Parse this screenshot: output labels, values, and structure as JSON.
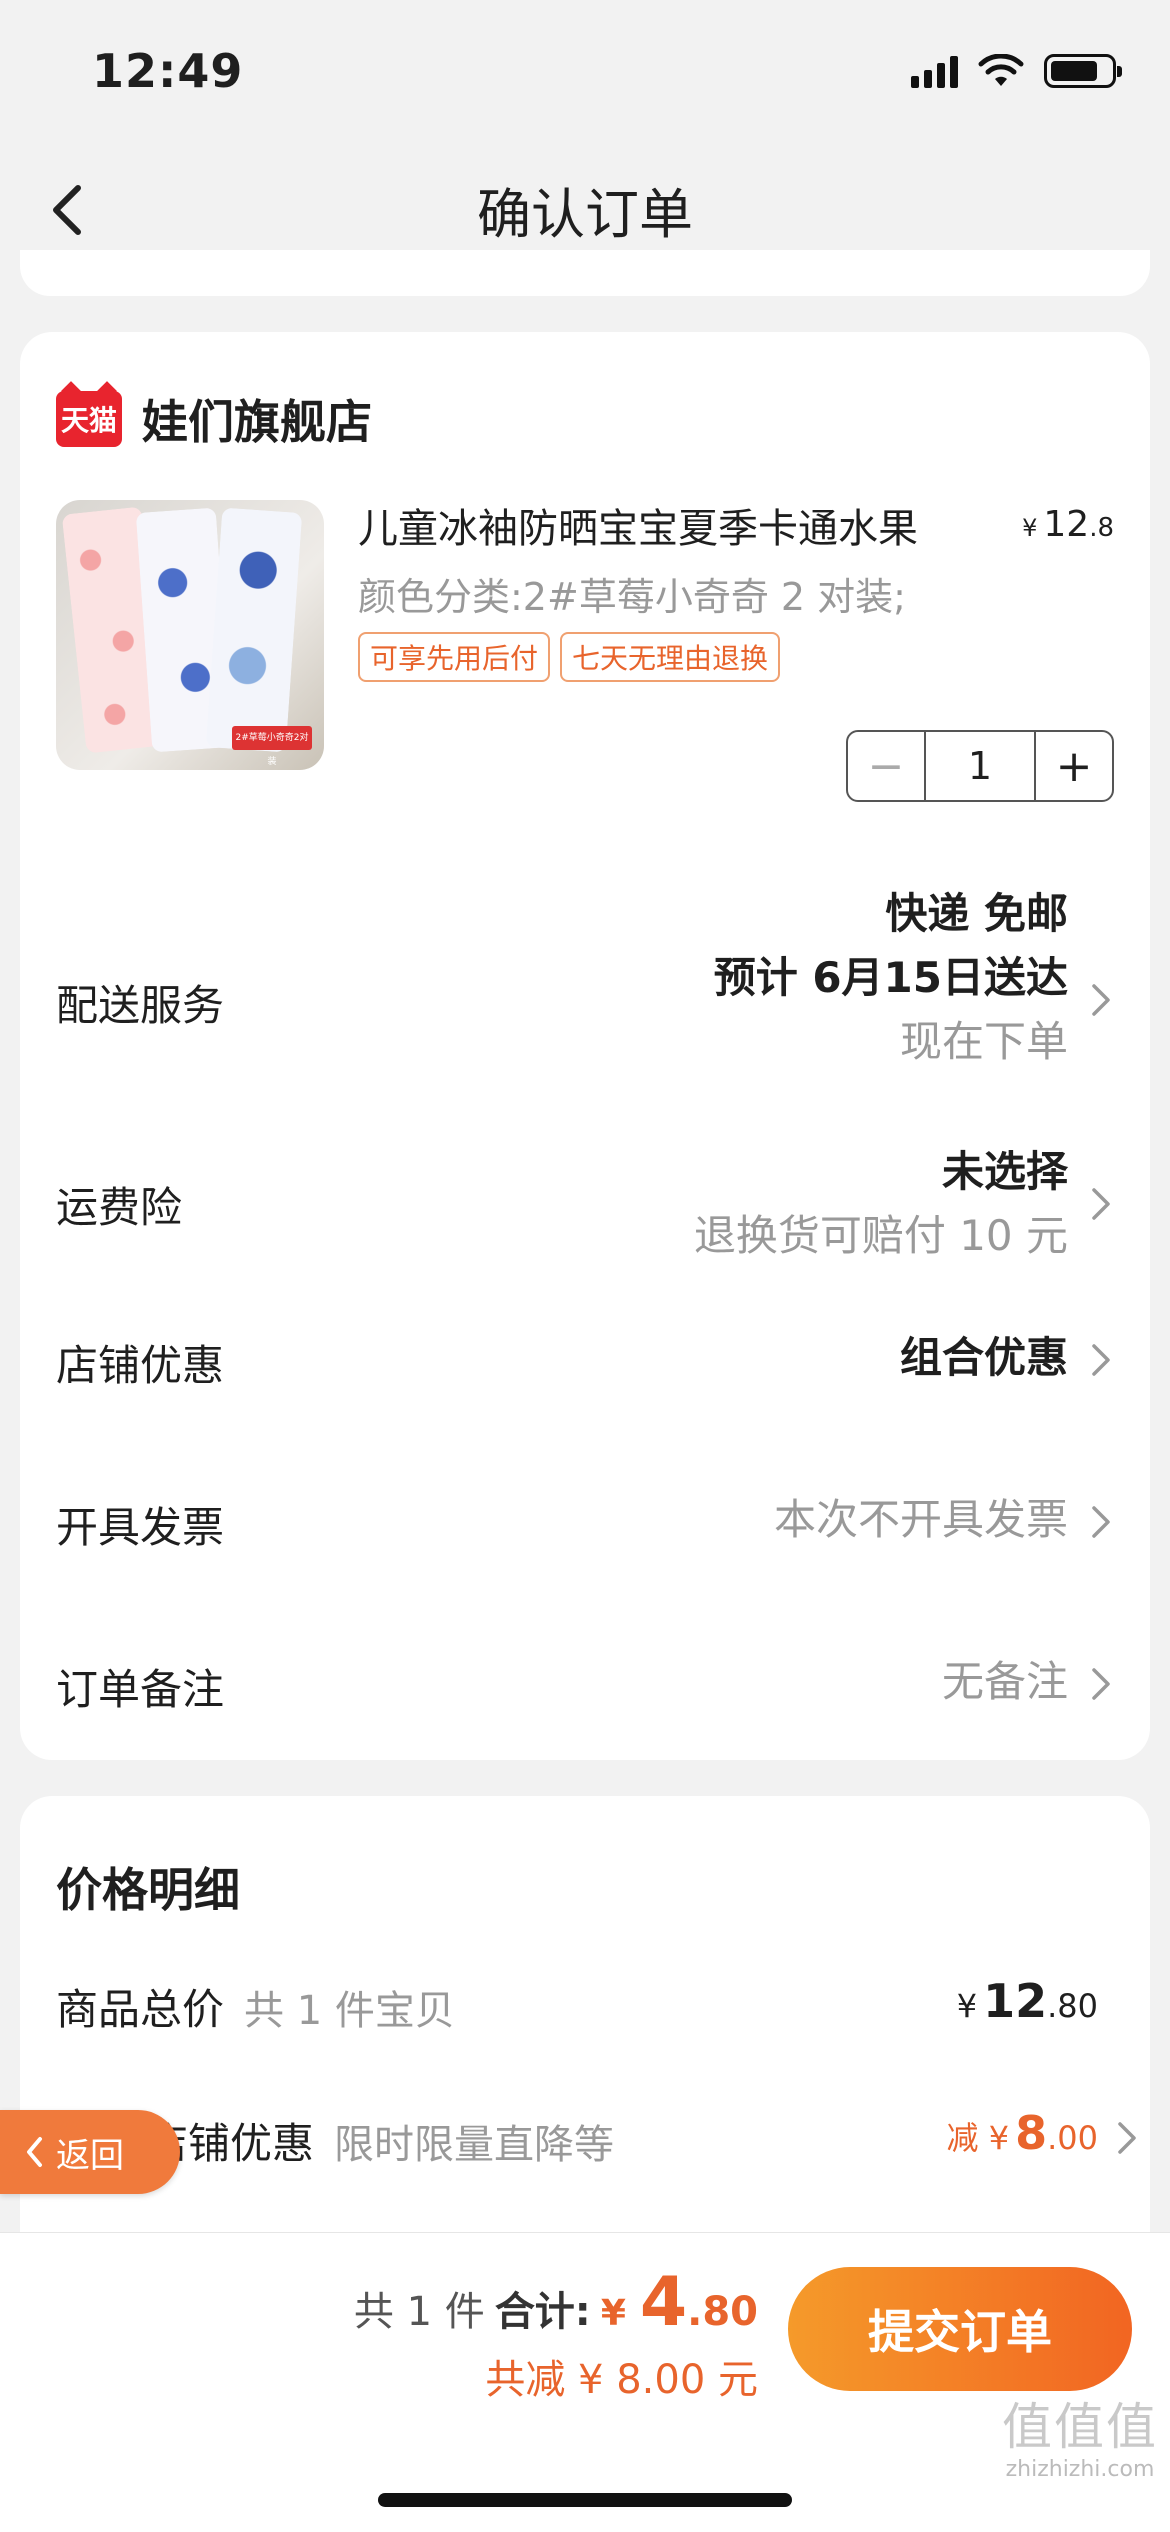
{
  "status_bar": {
    "time": "12:49"
  },
  "nav": {
    "title": "确认订单"
  },
  "store": {
    "badge": "天猫",
    "name": "娃们旗舰店"
  },
  "product": {
    "title": "儿童冰袖防晒宝宝夏季卡通水果",
    "price_yen": "¥",
    "price_int": "12",
    "price_cents": ".8",
    "sku": "颜色分类:2#草莓小奇奇 2 对装;",
    "tags": [
      "可享先用后付",
      "七天无理由退换"
    ],
    "image_label": "2#草莓小奇奇2对装",
    "quantity": "1",
    "minus": "−",
    "plus": "+"
  },
  "delivery": {
    "label": "配送服务",
    "line1": "快递 免邮",
    "line2": "预计 6月15日送达",
    "line3": "现在下单"
  },
  "insurance": {
    "label": "运费险",
    "line1": "未选择",
    "line2": "退换货可赔付 10 元"
  },
  "store_discount": {
    "label": "店铺优惠",
    "value": "组合优惠"
  },
  "invoice": {
    "label": "开具发票",
    "value": "本次不开具发票"
  },
  "remark": {
    "label": "订单备注",
    "value": "无备注"
  },
  "price_detail": {
    "title": "价格明细",
    "goods_total_label": "商品总价",
    "goods_total_sub": "共 1 件宝贝",
    "goods_total_yen": "¥",
    "goods_total_int": "12",
    "goods_total_cents": ".80",
    "discount_label": "店铺优惠",
    "discount_sub": "限时限量直降等",
    "discount_prefix": "减 ¥",
    "discount_int": "8",
    "discount_cents": ".00"
  },
  "back_float": {
    "label": "返回"
  },
  "bottom": {
    "count": "共 1 件",
    "total_label": "合计:",
    "total_yen": "¥",
    "total_int": "4",
    "total_cents": ".80",
    "saved": "共减 ¥ 8.00 元",
    "submit": "提交订单"
  },
  "watermark": {
    "glyphs": "值值值",
    "url": "zhizhizhi.com"
  },
  "colors": {
    "accent": "#e8642c",
    "button_start": "#f59a2a",
    "button_end": "#f26522",
    "tmall_red": "#e8242e"
  }
}
